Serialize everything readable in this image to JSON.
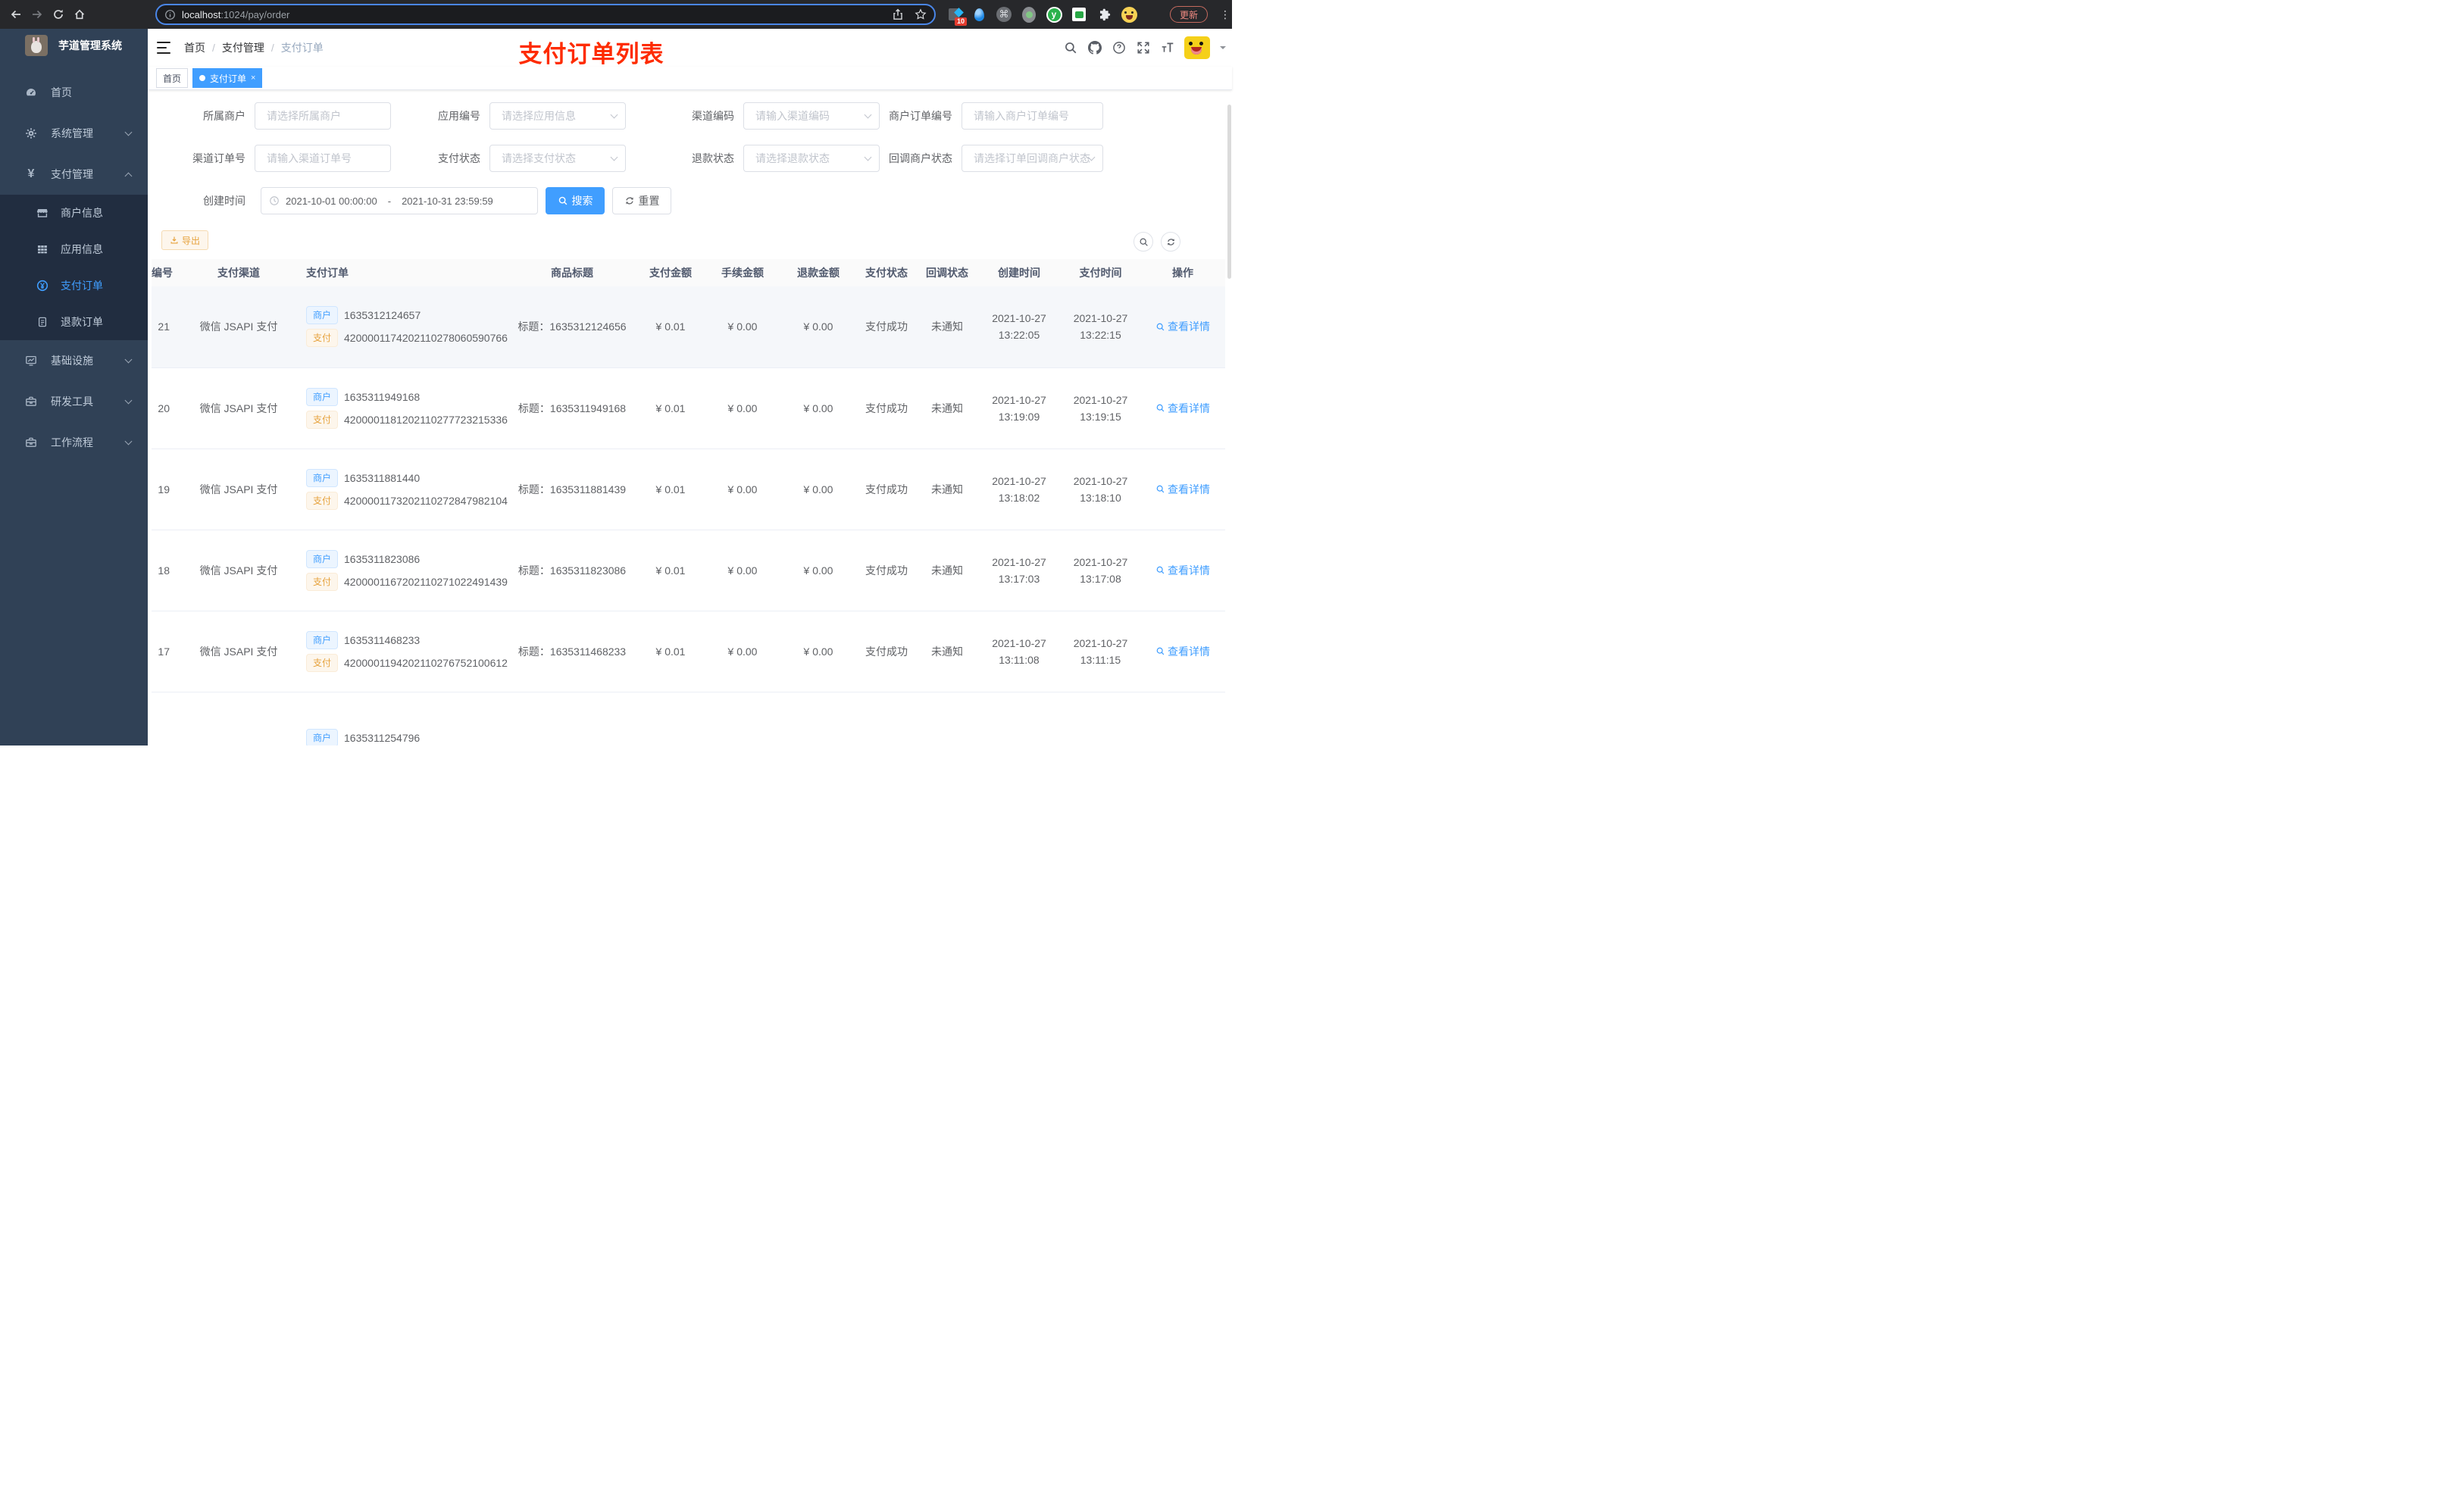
{
  "colors": {
    "accent": "#409eff",
    "warning": "#e6a23c",
    "annotation_red": "#fe2b00",
    "sidebar_bg": "#304156",
    "submenu_bg": "#212d40"
  },
  "browser": {
    "url_host": "localhost",
    "url_rest": ":1024/pay/order",
    "update_label": "更新",
    "ext_badge": "10",
    "cmd_glyph": "⌘",
    "y_glyph": "y",
    "kebab_glyph": "⋮"
  },
  "sidebar": {
    "title": "芋道管理系统",
    "menu": [
      {
        "label": "首页",
        "icon": "dashboard-icon",
        "level": "top"
      },
      {
        "label": "系统管理",
        "icon": "gear-icon",
        "level": "top",
        "chevron": "down"
      },
      {
        "label": "支付管理",
        "icon": "yen-icon",
        "level": "top",
        "chevron": "up"
      },
      {
        "label": "商户信息",
        "icon": "shop-icon",
        "level": "sub"
      },
      {
        "label": "应用信息",
        "icon": "grid-icon",
        "level": "sub"
      },
      {
        "label": "支付订单",
        "icon": "yen-circle-icon",
        "level": "sub",
        "active": true
      },
      {
        "label": "退款订单",
        "icon": "document-icon",
        "level": "sub"
      },
      {
        "label": "基础设施",
        "icon": "monitor-icon",
        "level": "top",
        "chevron": "down"
      },
      {
        "label": "研发工具",
        "icon": "toolbox-icon",
        "level": "top",
        "chevron": "down"
      },
      {
        "label": "工作流程",
        "icon": "toolbox-icon",
        "level": "top",
        "chevron": "down"
      }
    ]
  },
  "header": {
    "breadcrumb": [
      "首页",
      "支付管理",
      "支付订单"
    ],
    "separator": "/",
    "annotation": "支付订单列表"
  },
  "tabs": [
    {
      "label": "首页",
      "active": false
    },
    {
      "label": "支付订单",
      "active": true,
      "close_glyph": "×"
    }
  ],
  "filters": {
    "rows": [
      [
        {
          "label": "所属商户",
          "placeholder": "请选择所属商户",
          "type": "input"
        },
        {
          "label": "应用编号",
          "placeholder": "请选择应用信息",
          "type": "select"
        },
        {
          "label": "渠道编码",
          "placeholder": "请输入渠道编码",
          "type": "select"
        },
        {
          "label": "商户订单编号",
          "placeholder": "请输入商户订单编号",
          "type": "input"
        }
      ],
      [
        {
          "label": "渠道订单号",
          "placeholder": "请输入渠道订单号",
          "type": "input"
        },
        {
          "label": "支付状态",
          "placeholder": "请选择支付状态",
          "type": "select"
        },
        {
          "label": "退款状态",
          "placeholder": "请选择退款状态",
          "type": "select"
        },
        {
          "label": "回调商户状态",
          "placeholder": "请选择订单回调商户状态",
          "type": "select"
        }
      ]
    ],
    "date": {
      "label": "创建时间",
      "start": "2021-10-01 00:00:00",
      "separator": "-",
      "end": "2021-10-31 23:59:59"
    },
    "search_label": "搜索",
    "reset_label": "重置"
  },
  "toolbar": {
    "export_label": "导出"
  },
  "table": {
    "columns": [
      "编号",
      "支付渠道",
      "支付订单",
      "商品标题",
      "支付金额",
      "手续金额",
      "退款金额",
      "支付状态",
      "回调状态",
      "创建时间",
      "支付时间",
      "操作"
    ],
    "tag_merchant": "商户",
    "tag_pay": "支付",
    "title_prefix": "标题：",
    "action_label": "查看详情",
    "rows": [
      {
        "id": "21",
        "channel": "微信 JSAPI 支付",
        "merchant_no": "1635312124657",
        "pay_no": "4200001174202110278060590766",
        "title": "1635312124656",
        "amount": "¥ 0.01",
        "fee": "¥ 0.00",
        "refund": "¥ 0.00",
        "status": "支付成功",
        "notify": "未通知",
        "created_date": "2021-10-27",
        "created_time": "13:22:05",
        "paid_date": "2021-10-27",
        "paid_time": "13:22:15",
        "hovered": true
      },
      {
        "id": "20",
        "channel": "微信 JSAPI 支付",
        "merchant_no": "1635311949168",
        "pay_no": "4200001181202110277723215336",
        "title": "1635311949168",
        "amount": "¥ 0.01",
        "fee": "¥ 0.00",
        "refund": "¥ 0.00",
        "status": "支付成功",
        "notify": "未通知",
        "created_date": "2021-10-27",
        "created_time": "13:19:09",
        "paid_date": "2021-10-27",
        "paid_time": "13:19:15"
      },
      {
        "id": "19",
        "channel": "微信 JSAPI 支付",
        "merchant_no": "1635311881440",
        "pay_no": "4200001173202110272847982104",
        "title": "1635311881439",
        "amount": "¥ 0.01",
        "fee": "¥ 0.00",
        "refund": "¥ 0.00",
        "status": "支付成功",
        "notify": "未通知",
        "created_date": "2021-10-27",
        "created_time": "13:18:02",
        "paid_date": "2021-10-27",
        "paid_time": "13:18:10"
      },
      {
        "id": "18",
        "channel": "微信 JSAPI 支付",
        "merchant_no": "1635311823086",
        "pay_no": "4200001167202110271022491439",
        "title": "1635311823086",
        "amount": "¥ 0.01",
        "fee": "¥ 0.00",
        "refund": "¥ 0.00",
        "status": "支付成功",
        "notify": "未通知",
        "created_date": "2021-10-27",
        "created_time": "13:17:03",
        "paid_date": "2021-10-27",
        "paid_time": "13:17:08"
      },
      {
        "id": "17",
        "channel": "微信 JSAPI 支付",
        "merchant_no": "1635311468233",
        "pay_no": "4200001194202110276752100612",
        "title": "1635311468233",
        "amount": "¥ 0.01",
        "fee": "¥ 0.00",
        "refund": "¥ 0.00",
        "status": "支付成功",
        "notify": "未通知",
        "created_date": "2021-10-27",
        "created_time": "13:11:08",
        "paid_date": "2021-10-27",
        "paid_time": "13:11:15"
      },
      {
        "partial": true,
        "merchant_no": "1635311254796"
      }
    ]
  }
}
